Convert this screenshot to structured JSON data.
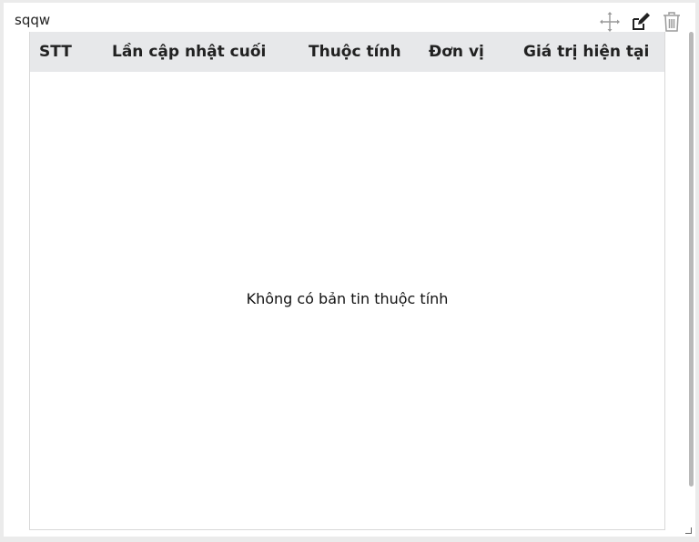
{
  "widget": {
    "title": "sqqw",
    "icons": [
      "move-icon",
      "edit-icon",
      "trash-icon"
    ]
  },
  "table": {
    "columns": [
      "STT",
      "Lần cập nhật cuối",
      "Thuộc tính",
      "Đơn vị",
      "Giá trị hiện tại"
    ],
    "rows": [],
    "empty_message": "Không có bản tin thuộc tính"
  },
  "colors": {
    "header_bg": "#e7e8ea",
    "page_bg": "#ebebeb",
    "icon_gray": "#9a9a9a",
    "icon_dark": "#222222"
  }
}
